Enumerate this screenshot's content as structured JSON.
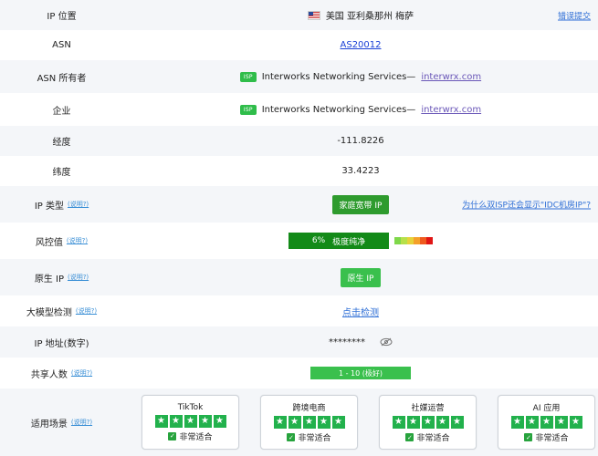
{
  "rows": {
    "ip_location": {
      "label": "IP 位置",
      "value": "美国 亚利桑那州 梅萨",
      "right_link": "错误提交"
    },
    "asn": {
      "label": "ASN",
      "value": "AS20012"
    },
    "asn_owner": {
      "label": "ASN 所有者",
      "badge": "ISP",
      "company": "Interworks Networking Services—",
      "domain": "interwrx.com"
    },
    "enterprise": {
      "label": "企业",
      "badge": "ISP",
      "company": "Interworks Networking Services—",
      "domain": "interwrx.com"
    },
    "longitude": {
      "label": "经度",
      "value": "-111.8226"
    },
    "latitude": {
      "label": "纬度",
      "value": "33.4223"
    },
    "ip_type": {
      "label": "IP 类型",
      "help": "(说明?)",
      "value": "家庭宽带 IP",
      "right_link": "为什么双ISP还会显示\"IDC机房IP\"?"
    },
    "risk": {
      "label": "风控值",
      "help": "(说明?)",
      "percent": "6%",
      "text": "极度纯净"
    },
    "native_ip": {
      "label": "原生 IP",
      "help": "(说明?)",
      "value": "原生 IP"
    },
    "llm_check": {
      "label": "大模型检测",
      "help": "(说明?)",
      "value": "点击检测"
    },
    "ip_numeric": {
      "label": "IP 地址(数字)",
      "value": "********"
    },
    "shared_users": {
      "label": "共享人数",
      "help": "(说明?)",
      "value": "1 - 10 (极好)"
    },
    "scenarios": {
      "label": "适用场景",
      "help": "(说明?)",
      "cards": [
        {
          "title": "TikTok",
          "fit": "非常适合"
        },
        {
          "title": "跨境电商",
          "fit": "非常适合"
        },
        {
          "title": "社媒运营",
          "fit": "非常适合"
        },
        {
          "title": "AI 应用",
          "fit": "非常适合"
        }
      ]
    }
  },
  "colors": {
    "accent_green": "#2e9b2e",
    "star_green": "#22b14c",
    "link_blue": "#1a40d6"
  }
}
